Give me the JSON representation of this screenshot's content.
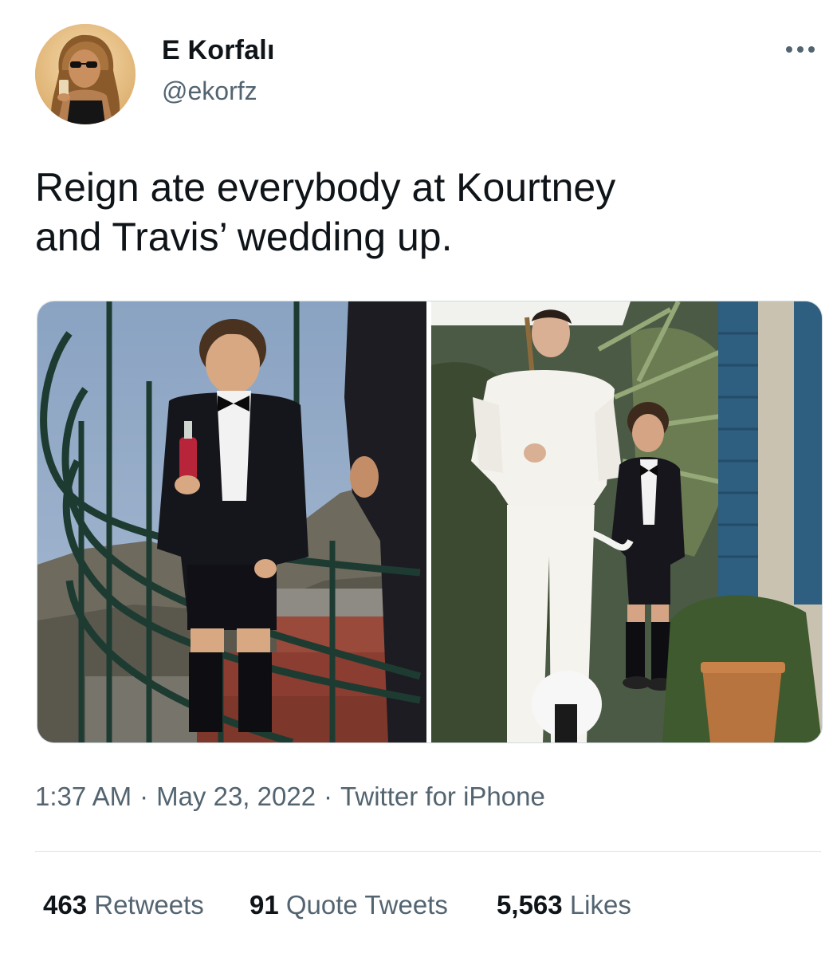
{
  "user": {
    "display_name": "E Korfalı",
    "handle": "@ekorfz"
  },
  "more_icon": "ellipsis-icon",
  "tweet": {
    "text_line1": "Reign ate everybody at Kourtney",
    "text_line2": "and Travis’ wedding up."
  },
  "meta": {
    "time": "1:37 AM",
    "separator": "·",
    "date": "May 23, 2022",
    "source": "Twitter for iPhone"
  },
  "stats": {
    "retweets_count": "463",
    "retweets_label": "Retweets",
    "quotes_count": "91",
    "quotes_label": "Quote Tweets",
    "likes_count": "5,563",
    "likes_label": "Likes"
  },
  "colors": {
    "text_primary": "#0f1419",
    "text_secondary": "#536471",
    "divider": "#dfe4e8"
  }
}
